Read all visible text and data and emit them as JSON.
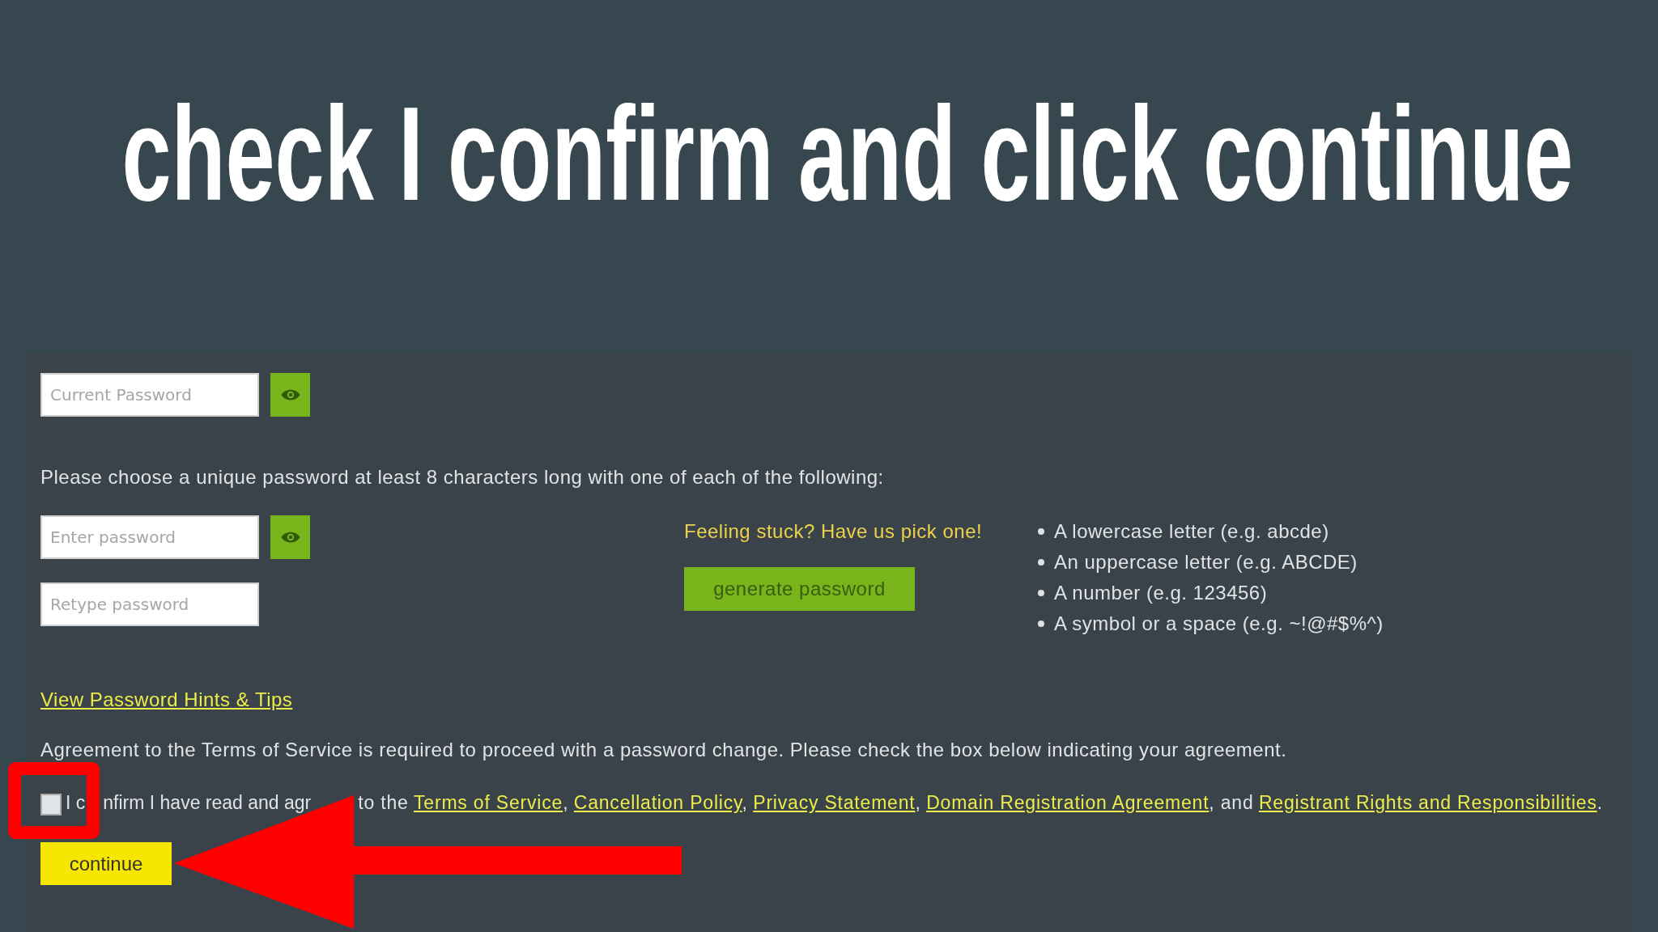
{
  "title": "check I confirm and click continue",
  "form": {
    "current_password": {
      "placeholder": "Current Password"
    },
    "instructions": "Please choose a unique password at least 8 characters long with one of each of the following:",
    "new_password": {
      "placeholder": "Enter password"
    },
    "retype_password": {
      "placeholder": "Retype password"
    },
    "generator": {
      "prompt": "Feeling stuck? Have us pick one!",
      "button": "generate password"
    },
    "requirements": [
      "A lowercase letter (e.g. abcde)",
      "An uppercase letter (e.g. ABCDE)",
      "A number (e.g. 123456)",
      "A symbol or a space (e.g. ~!@#$%^)"
    ],
    "hints_link": "View Password Hints & Tips",
    "agreement_notice": "Agreement to the Terms of Service is required to proceed with a password change. Please check the box below indicating your agreement.",
    "confirm": {
      "checked": false,
      "segments": [
        {
          "kind": "obscured",
          "text": "I c"
        },
        {
          "kind": "obscured",
          "text": "nfirm I have read and agr"
        },
        {
          "kind": "text",
          "text": "to the"
        },
        {
          "kind": "link",
          "text": "Terms of Service"
        },
        {
          "kind": "suffix",
          "text": ","
        },
        {
          "kind": "link",
          "text": "Cancellation Policy"
        },
        {
          "kind": "suffix",
          "text": ","
        },
        {
          "kind": "link",
          "text": "Privacy Statement"
        },
        {
          "kind": "suffix",
          "text": ","
        },
        {
          "kind": "link",
          "text": "Domain Registration Agreement"
        },
        {
          "kind": "suffix",
          "text": ", and"
        },
        {
          "kind": "link",
          "text": "Registrant Rights and Responsibilities"
        },
        {
          "kind": "suffix",
          "text": "."
        }
      ]
    },
    "continue_button": "continue"
  }
}
